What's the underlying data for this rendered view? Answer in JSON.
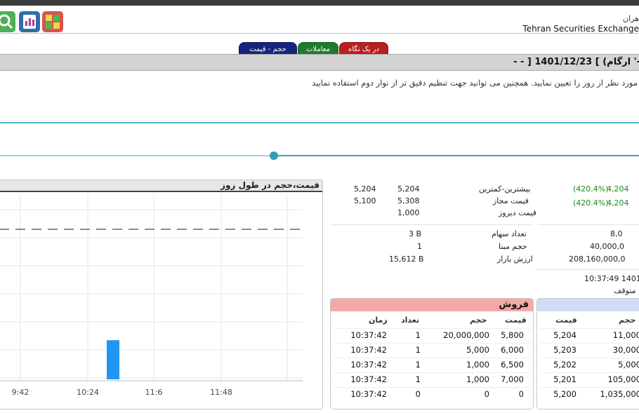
{
  "header": {
    "brand_fa": "هران",
    "brand_en": "Tehran Securities Exchange"
  },
  "tabs": [
    {
      "label": "حجم - قیمت"
    },
    {
      "label": "معاملات"
    },
    {
      "label": "در یک نگاه"
    }
  ],
  "title": "- - ] 1401/12/23 [ (ارگام '-",
  "instructions": "مورد نظر از روز را تعیین نمایید. همچنین می توانید جهت تنظیم دقیق تر از نوار دوم استفاده نمایید",
  "chart": {
    "title": "قیمت،حجم در طول روز"
  },
  "chart_data": {
    "type": "bar",
    "x_tick_labels": [
      "9:42",
      "10:24",
      "11:6",
      "11:48"
    ],
    "bars": [
      {
        "x": "10:30",
        "volume_level": 0.62
      }
    ],
    "reference_line": "dashed",
    "grid": true
  },
  "info": {
    "range_label": "بیشترین-کمترین",
    "range_a": "5,204",
    "range_b": "5,204",
    "allowed_label": "قیمت مجاز",
    "allowed_a": "5,308",
    "allowed_b": "5,100",
    "yesterday_label": "قیمت دیروز",
    "yesterday": "1,000",
    "left_last": "4,204",
    "left_last_pct": "(420.4%)",
    "left_close": "4,204",
    "left_close_pct": "(420.4%)",
    "shares_label": "تعداد سهام",
    "shares": "3 B",
    "base_vol_label": "حجم مبنا",
    "base_vol": "1",
    "mcap_label": "ارزش بازار",
    "mcap": "15,612 B",
    "right_shares": "8,0",
    "right_basevol": "40,000,0",
    "right_value": "208,160,000,0",
    "time_status": "10:37:49 1401/",
    "status": "متوقف"
  },
  "sell": {
    "title": "فروش",
    "headers": {
      "price": "قیمت",
      "volume": "حجم",
      "count": "تعداد",
      "time": "زمان"
    },
    "rows": [
      {
        "price": "5,800",
        "volume": "20,000,000",
        "count": "1",
        "time": "10:37:42"
      },
      {
        "price": "6,000",
        "volume": "5,000",
        "count": "1",
        "time": "10:37:42"
      },
      {
        "price": "6,500",
        "volume": "1,000",
        "count": "1",
        "time": "10:37:42"
      },
      {
        "price": "7,000",
        "volume": "1,000",
        "count": "1",
        "time": "10:37:42"
      },
      {
        "price": "0",
        "volume": "0",
        "count": "0",
        "time": "10:37:42"
      }
    ]
  },
  "buy": {
    "headers": {
      "price": "قیمت",
      "volume": "حجم"
    },
    "rows": [
      {
        "price": "5,204",
        "volume": "11,000"
      },
      {
        "price": "5,203",
        "volume": "30,000"
      },
      {
        "price": "5,202",
        "volume": "5,000"
      },
      {
        "price": "5,201",
        "volume": "105,000"
      },
      {
        "price": "5,200",
        "volume": "1,035,000"
      }
    ]
  },
  "colors": {
    "accent": "#2f9fb3",
    "bar": "#2196f3",
    "sell_header": "#f4a8a8",
    "buy_header": "#cfdcf4",
    "positive": "#1a8a1a"
  }
}
